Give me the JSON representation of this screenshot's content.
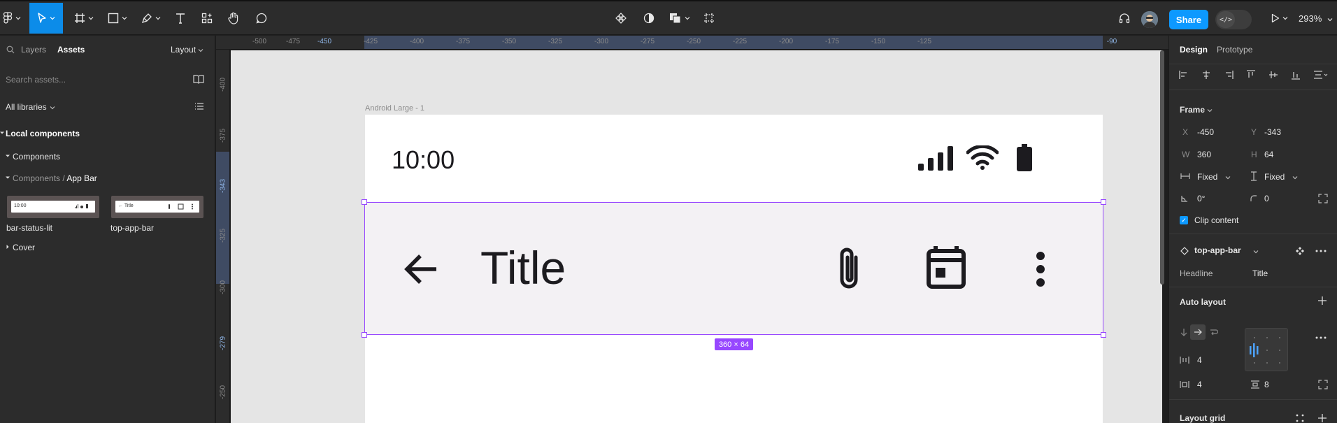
{
  "toolbar": {
    "zoom": "293%",
    "share_label": "Share",
    "dev_mode_icon": "</>",
    "tools": [
      "main-menu",
      "move",
      "frame",
      "rectangle",
      "pen",
      "text",
      "actions",
      "hand",
      "comment"
    ],
    "center_tools": [
      "component",
      "mask",
      "boolean",
      "crop"
    ],
    "accent": "#0c8ce9"
  },
  "left_panel": {
    "tabs": {
      "layers": "Layers",
      "assets": "Assets",
      "layout": "Layout"
    },
    "search_placeholder": "Search assets...",
    "libraries": "All libraries",
    "local_components": "Local components",
    "components": "Components",
    "path_parent": "Components",
    "path_sep": "/",
    "path_child": "App Bar",
    "thumbs": [
      {
        "label": "bar-status-lit",
        "mini": "10:00"
      },
      {
        "label": "top-app-bar",
        "mini": "Title"
      }
    ],
    "cover": "Cover"
  },
  "rulers": {
    "top": [
      "-500",
      "-475",
      "-450",
      "-425",
      "-400",
      "-375",
      "-350",
      "-325",
      "-300",
      "-275",
      "-250",
      "-225",
      "-200",
      "-175",
      "-150",
      "-125",
      "-90"
    ],
    "left": [
      "-400",
      "-375",
      "-343",
      "-325",
      "-300",
      "-279",
      "-250"
    ]
  },
  "canvas": {
    "frame_name": "Android Large - 1",
    "status_time": "10:00",
    "app_bar_title": "Title",
    "selection_size": "360 × 64",
    "selection_color": "#9747ff"
  },
  "right_panel": {
    "tabs": {
      "design": "Design",
      "prototype": "Prototype"
    },
    "frame_section": "Frame",
    "x_label": "X",
    "x": "-450",
    "y_label": "Y",
    "y": "-343",
    "w_label": "W",
    "w": "360",
    "h_label": "H",
    "h": "64",
    "h_sizing": "Fixed",
    "v_sizing": "Fixed",
    "rotation": "0°",
    "radius": "0",
    "clip_content": "Clip content",
    "instance_name": "top-app-bar",
    "prop_name": "Headline",
    "prop_value": "Title",
    "auto_layout": "Auto layout",
    "gap": "4",
    "padding_h": "4",
    "padding_v": "8",
    "layout_grid": "Layout grid"
  }
}
